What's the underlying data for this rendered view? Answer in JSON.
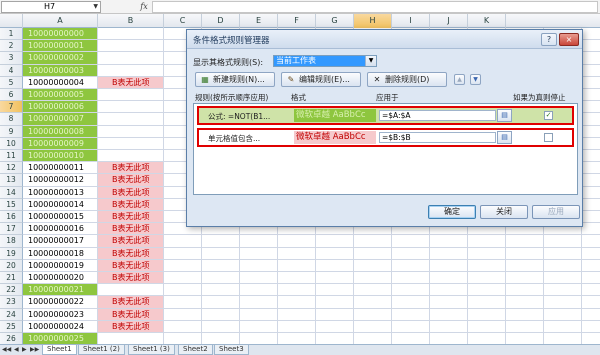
{
  "formula_bar": {
    "name_box": "H7",
    "fx_label": "fx",
    "formula": ""
  },
  "columns": [
    "A",
    "B",
    "C",
    "D",
    "E",
    "F",
    "G",
    "H",
    "I",
    "J",
    "K"
  ],
  "selected_column": "H",
  "selected_row": 7,
  "rows": [
    {
      "num": "1",
      "a": "10000000000",
      "b": "",
      "a_highlight": true,
      "b_highlight": false
    },
    {
      "num": "2",
      "a": "10000000001",
      "b": "",
      "a_highlight": true,
      "b_highlight": false
    },
    {
      "num": "3",
      "a": "10000000002",
      "b": "",
      "a_highlight": true,
      "b_highlight": false
    },
    {
      "num": "4",
      "a": "10000000003",
      "b": "",
      "a_highlight": true,
      "b_highlight": false
    },
    {
      "num": "5",
      "a": "10000000004",
      "b": "B表无此项",
      "a_highlight": false,
      "b_highlight": true
    },
    {
      "num": "6",
      "a": "10000000005",
      "b": "",
      "a_highlight": true,
      "b_highlight": false
    },
    {
      "num": "7",
      "a": "10000000006",
      "b": "",
      "a_highlight": true,
      "b_highlight": false
    },
    {
      "num": "8",
      "a": "10000000007",
      "b": "",
      "a_highlight": true,
      "b_highlight": false
    },
    {
      "num": "9",
      "a": "10000000008",
      "b": "",
      "a_highlight": true,
      "b_highlight": false
    },
    {
      "num": "10",
      "a": "10000000009",
      "b": "",
      "a_highlight": true,
      "b_highlight": false
    },
    {
      "num": "11",
      "a": "10000000010",
      "b": "",
      "a_highlight": true,
      "b_highlight": false
    },
    {
      "num": "12",
      "a": "10000000011",
      "b": "B表无此项",
      "a_highlight": false,
      "b_highlight": true
    },
    {
      "num": "13",
      "a": "10000000012",
      "b": "B表无此项",
      "a_highlight": false,
      "b_highlight": true
    },
    {
      "num": "14",
      "a": "10000000013",
      "b": "B表无此项",
      "a_highlight": false,
      "b_highlight": true
    },
    {
      "num": "15",
      "a": "10000000014",
      "b": "B表无此项",
      "a_highlight": false,
      "b_highlight": true
    },
    {
      "num": "16",
      "a": "10000000015",
      "b": "B表无此项",
      "a_highlight": false,
      "b_highlight": true
    },
    {
      "num": "17",
      "a": "10000000016",
      "b": "B表无此项",
      "a_highlight": false,
      "b_highlight": true
    },
    {
      "num": "18",
      "a": "10000000017",
      "b": "B表无此项",
      "a_highlight": false,
      "b_highlight": true
    },
    {
      "num": "19",
      "a": "10000000018",
      "b": "B表无此项",
      "a_highlight": false,
      "b_highlight": true
    },
    {
      "num": "20",
      "a": "10000000019",
      "b": "B表无此项",
      "a_highlight": false,
      "b_highlight": true
    },
    {
      "num": "21",
      "a": "10000000020",
      "b": "B表无此项",
      "a_highlight": false,
      "b_highlight": true
    },
    {
      "num": "22",
      "a": "10000000021",
      "b": "",
      "a_highlight": true,
      "b_highlight": false
    },
    {
      "num": "23",
      "a": "10000000022",
      "b": "B表无此项",
      "a_highlight": false,
      "b_highlight": true
    },
    {
      "num": "24",
      "a": "10000000023",
      "b": "B表无此项",
      "a_highlight": false,
      "b_highlight": true
    },
    {
      "num": "25",
      "a": "10000000024",
      "b": "B表无此项",
      "a_highlight": false,
      "b_highlight": true
    },
    {
      "num": "26",
      "a": "10000000025",
      "b": "",
      "a_highlight": true,
      "b_highlight": false
    }
  ],
  "sheet_tabs": [
    "Sheet1",
    "Sheet1 (2)",
    "Sheet1 (3)",
    "Sheet2",
    "Sheet3"
  ],
  "active_sheet": "Sheet1",
  "dialog": {
    "title": "条件格式规则管理器",
    "help_label": "?",
    "close_label": "×",
    "show_rules_label": "显示其格式规则(S):",
    "show_rules_value": "当前工作表",
    "new_rule_label": "新建规则(N)...",
    "edit_rule_label": "编辑规则(E)...",
    "delete_rule_label": "删除规则(D)",
    "move_up_label": "▲",
    "move_down_label": "▼",
    "headers": {
      "rule": "规则(按所示顺序应用)",
      "format": "格式",
      "applies_to": "应用于",
      "stop_if_true": "如果为真则停止"
    },
    "rules": [
      {
        "label": "公式: =NOT(B1...",
        "preview": "微软卓越  AaBbCc",
        "applies_to": "=$A:$A",
        "stop_if_true": true,
        "selected": true,
        "preview_color": "#8ec63f"
      },
      {
        "label": "单元格值包含...",
        "preview": "微软卓越  AaBbCc",
        "applies_to": "=$B:$B",
        "stop_if_true": false,
        "selected": false,
        "preview_color": "#f6c9cc"
      }
    ],
    "ok_label": "确定",
    "close_button_label": "关闭",
    "apply_label": "应用"
  },
  "colors": {
    "green_fill": "#8ec63f",
    "pink_fill": "#f6c9cc",
    "pink_text": "#c00000",
    "annotation_red": "#e00000"
  }
}
